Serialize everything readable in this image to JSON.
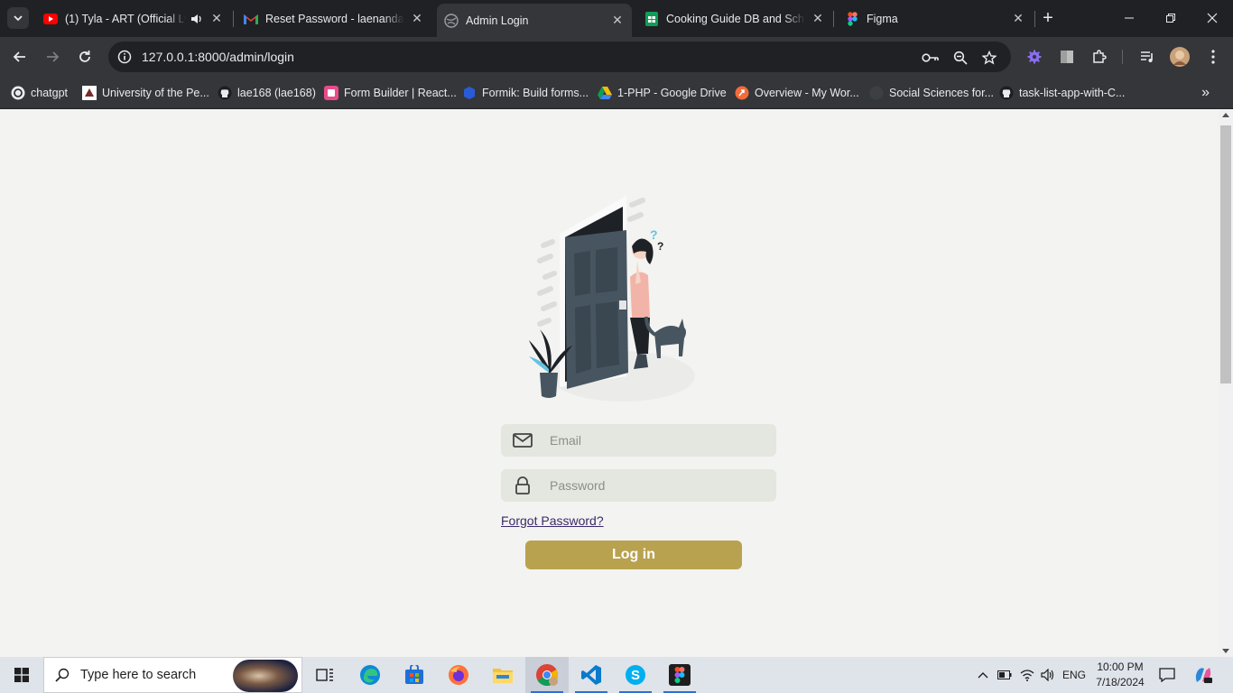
{
  "browser": {
    "tabs": [
      {
        "title": "(1) Tyla - ART (Official Lyric",
        "icon": "youtube-icon",
        "audio": true
      },
      {
        "title": "Reset Password - laenandara",
        "icon": "gmail-icon"
      },
      {
        "title": "Admin Login",
        "icon": "globe-icon",
        "active": true
      },
      {
        "title": "Cooking Guide DB and Sche",
        "icon": "sheets-icon"
      },
      {
        "title": "Figma",
        "icon": "figma-icon"
      }
    ],
    "url": "127.0.0.1:8000/admin/login",
    "bookmarks": [
      {
        "label": "chatgpt",
        "icon": "chatgpt-icon"
      },
      {
        "label": "University of the Pe...",
        "icon": "university-icon"
      },
      {
        "label": "lae168 (lae168)",
        "icon": "github-icon"
      },
      {
        "label": "Form Builder | React...",
        "icon": "formbuilder-icon"
      },
      {
        "label": "Formik: Build forms...",
        "icon": "formik-icon"
      },
      {
        "label": "1-PHP - Google Drive",
        "icon": "drive-icon"
      },
      {
        "label": "Overview - My Wor...",
        "icon": "overview-icon"
      },
      {
        "label": "Social Sciences for...",
        "icon": "social-icon"
      },
      {
        "label": "task-list-app-with-C...",
        "icon": "github-icon"
      }
    ]
  },
  "login": {
    "email_placeholder": "Email",
    "password_placeholder": "Password",
    "forgot_label": "Forgot Password?",
    "login_label": "Log in"
  },
  "taskbar": {
    "search_placeholder": "Type here to search",
    "language": "ENG",
    "time": "10:00 PM",
    "date": "7/18/2024"
  },
  "colors": {
    "accent_button": "#b9a24f",
    "field_bg": "#e3e7df",
    "page_bg": "#f3f3f1",
    "door": "#475560"
  }
}
